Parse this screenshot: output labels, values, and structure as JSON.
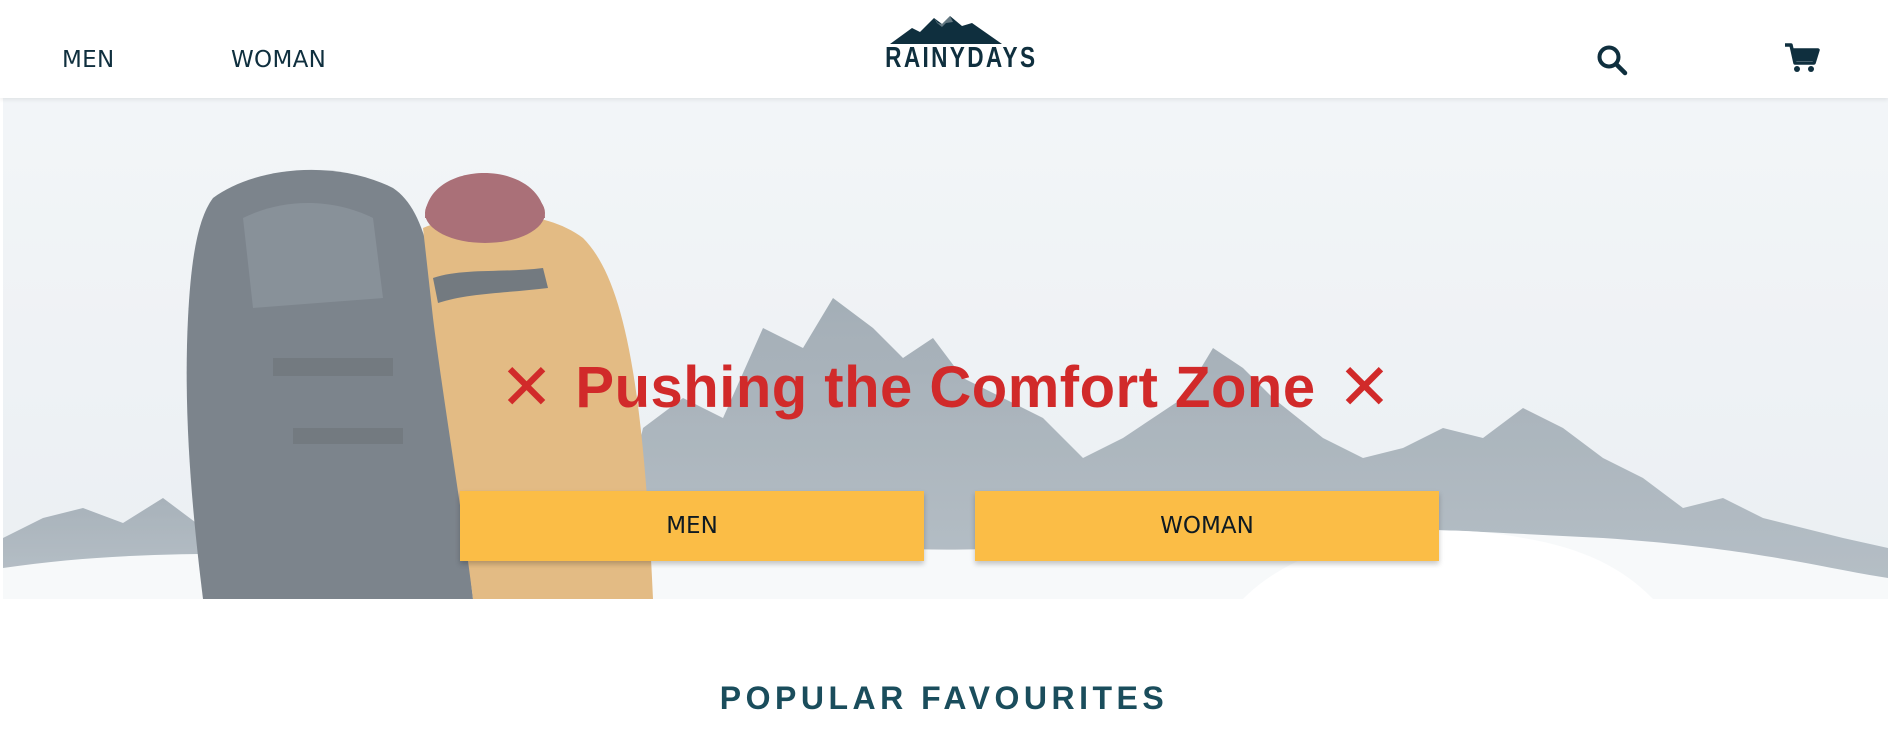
{
  "nav": {
    "left_links": [
      {
        "label": "MEN"
      },
      {
        "label": "WOMAN"
      }
    ],
    "logo_text": "RAINYDAYS",
    "icons": [
      "search-icon",
      "cart-icon"
    ]
  },
  "hero": {
    "title": "Pushing the Comfort Zone",
    "decoration_glyph": "✕",
    "buttons": [
      {
        "label": "MEN"
      },
      {
        "label": "WOMAN"
      }
    ]
  },
  "sections": {
    "popular_title": "POPULAR FAVOURITES"
  },
  "colors": {
    "brand_dark": "#0f2f3e",
    "accent_red": "#d12a2a",
    "button_yellow": "#fbbd46",
    "section_title": "#1a4d5c"
  }
}
